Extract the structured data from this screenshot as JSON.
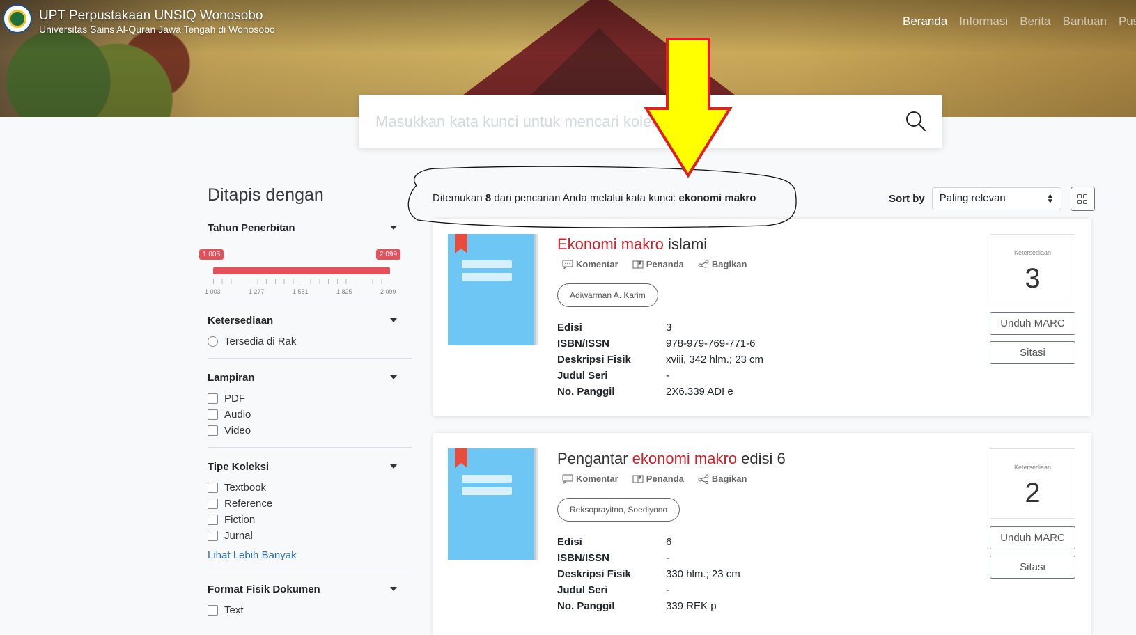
{
  "header": {
    "title": "UPT Perpustakaan UNSIQ Wonosobo",
    "subtitle": "Universitas Sains Al-Quran Jawa Tengah di Wonosobo",
    "nav": [
      "Beranda",
      "Informasi",
      "Berita",
      "Bantuan",
      "Pus"
    ]
  },
  "search": {
    "placeholder": "Masukkan kata kunci untuk mencari koleksi"
  },
  "sidebar": {
    "title": "Ditapis dengan",
    "year": {
      "label": "Tahun Penerbitan",
      "min_badge": "1 003",
      "max_badge": "2 099",
      "min_value": 1003,
      "max_value": 2099,
      "ticks": [
        "1 003",
        "1 277",
        "1 551",
        "1 825",
        "2 099"
      ]
    },
    "availability": {
      "label": "Ketersediaan",
      "option": "Tersedia di Rak"
    },
    "attachment": {
      "label": "Lampiran",
      "options": [
        "PDF",
        "Audio",
        "Video"
      ]
    },
    "collection_type": {
      "label": "Tipe Koleksi",
      "options": [
        "Textbook",
        "Reference",
        "Fiction",
        "Jurnal"
      ],
      "more": "Lihat Lebih Banyak"
    },
    "physical_format": {
      "label": "Format Fisik Dokumen",
      "options": [
        "Text"
      ]
    }
  },
  "results": {
    "found_prefix": "Ditemukan ",
    "count": "8",
    "found_mid": " dari pencarian Anda melalui kata kunci: ",
    "keyword": "ekonomi makro",
    "sort_label": "Sort by",
    "sort_value": "Paling relevan",
    "action_labels": {
      "comment": "Komentar",
      "bookmark": "Penanda",
      "share": "Bagikan"
    },
    "avail_caption": "Ketersediaan",
    "meta_labels": {
      "edition": "Edisi",
      "isbn": "ISBN/ISSN",
      "physical": "Deskripsi Fisik",
      "series": "Judul Seri",
      "call": "No. Panggil"
    },
    "button_marc": "Unduh MARC",
    "button_cite": "Sitasi",
    "items": [
      {
        "title_pre": "",
        "title_hl": "Ekonomi makro",
        "title_post": " islami",
        "author": "Adiwarman A. Karim",
        "edition": "3",
        "isbn": "978-979-769-771-6",
        "physical": "xviii, 342 hlm.; 23 cm",
        "series": "-",
        "call": "2X6.339 ADI e",
        "availability": "3"
      },
      {
        "title_pre": "Pengantar ",
        "title_hl": "ekonomi makro",
        "title_post": " edisi 6",
        "author": "Reksoprayitno, Soediyono",
        "edition": "6",
        "isbn": "-",
        "physical": "330 hlm.; 23 cm",
        "series": "-",
        "call": "339 REK p",
        "availability": "2"
      }
    ]
  },
  "colors": {
    "accent": "#d0212b",
    "range": "#e4515a",
    "arrow_fill": "#ffff00",
    "arrow_stroke": "#e02020",
    "link": "#2a6fb5"
  }
}
